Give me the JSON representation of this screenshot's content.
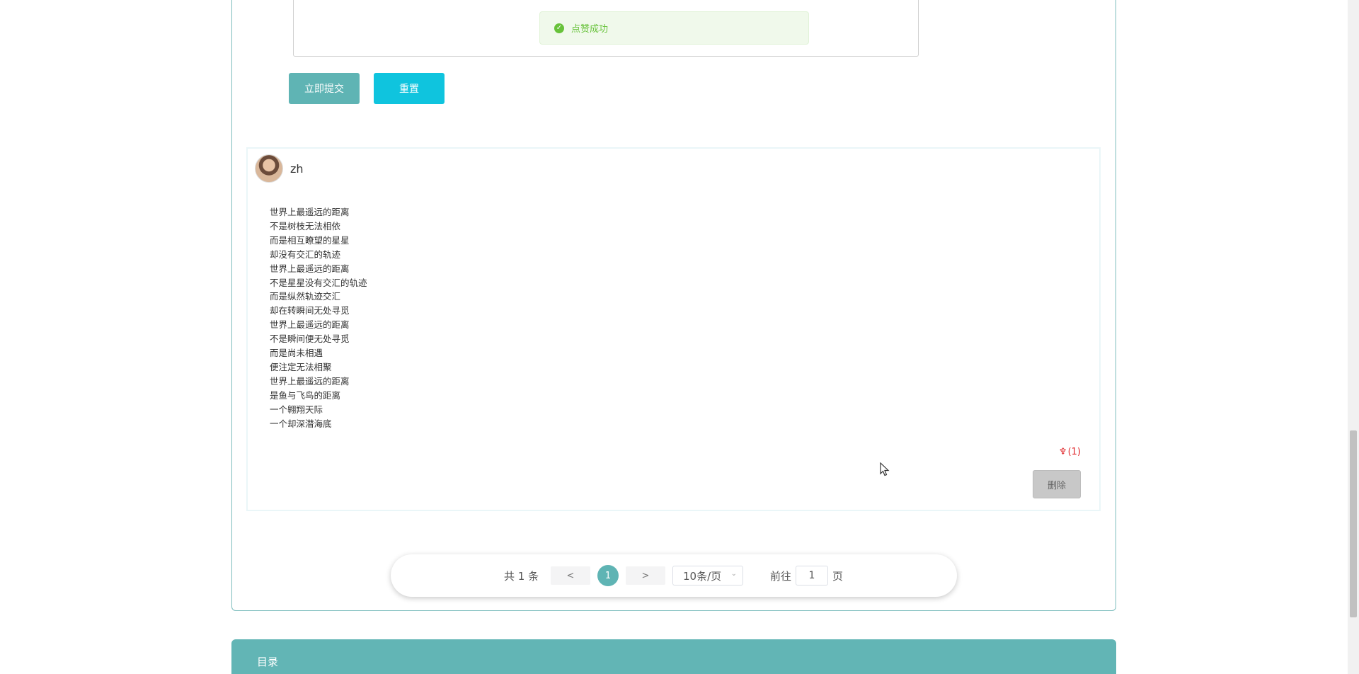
{
  "toast": {
    "message": "点赞成功"
  },
  "form": {
    "submit_label": "立即提交",
    "reset_label": "重置"
  },
  "comment": {
    "username": "zh",
    "lines": [
      "世界上最遥远的距离",
      "不是树枝无法相依",
      "而是相互瞭望的星星",
      "却没有交汇的轨迹",
      "世界上最遥远的距离",
      "不是星星没有交汇的轨迹",
      "而是纵然轨迹交汇",
      "却在转瞬间无处寻觅",
      "世界上最遥远的距离",
      "不是瞬间便无处寻觅",
      "而是尚未相遇",
      "便注定无法相聚",
      "世界上最遥远的距离",
      "是鱼与飞鸟的距离",
      "一个翱翔天际",
      "一个却深潜海底"
    ],
    "like_icon": "♆",
    "like_count": "(1)",
    "delete_label": "删除"
  },
  "pagination": {
    "total_text": "共 1 条",
    "prev_label": "<",
    "current_page": "1",
    "next_label": ">",
    "page_size": "10条/页",
    "goto_label": "前往",
    "goto_value": "1",
    "goto_suffix": "页"
  },
  "directory": {
    "title": "目录"
  },
  "colors": {
    "accent": "#5fb4b4",
    "reset_button": "#0fc4de",
    "success": "#67c23a",
    "like": "#e0292d"
  }
}
